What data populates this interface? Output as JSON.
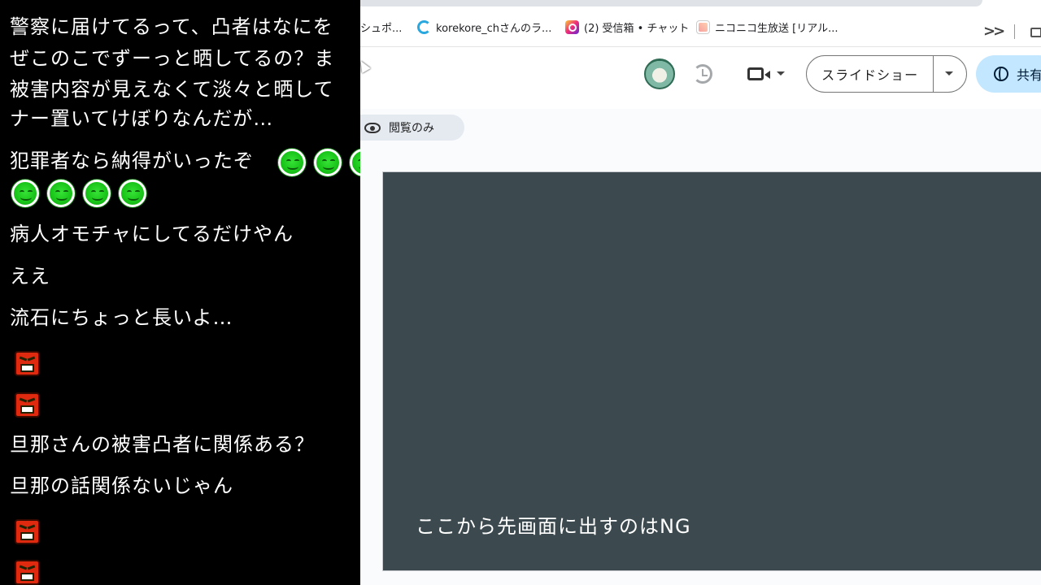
{
  "chat": {
    "messages": [
      "警察に届けてるって、凸者はなにを",
      "ぜこのこでずーっと晒してるの？ま",
      "被害内容が見えなくて淡々と晒して",
      "ナー置いてけぼりなんだが…",
      "犯罪者なら納得がいったぞ",
      "病人オモチャにしてるだけやん",
      "ええ",
      "流石にちょっと長いよ…",
      "旦那さんの被害凸者に関係ある？",
      "旦那の話関係ないじゃん"
    ],
    "emote_names": [
      "green-smiley-emote",
      "angry-face-emote"
    ]
  },
  "bookmarks": {
    "items": [
      "シュポ...",
      "korekore_chさんのラ...",
      "(2) 受信箱 • チャット",
      "ニコニコ生放送 [リアル..."
    ],
    "more_icon": "chevron-double-right"
  },
  "toolbar": {
    "slideshow_label": "スライドショー",
    "share_label": "共有"
  },
  "subbar": {
    "view_only_label": "閲覧のみ"
  },
  "slide": {
    "text": "ここから先画面に出すのはNG",
    "background": "#3c4a4f"
  }
}
